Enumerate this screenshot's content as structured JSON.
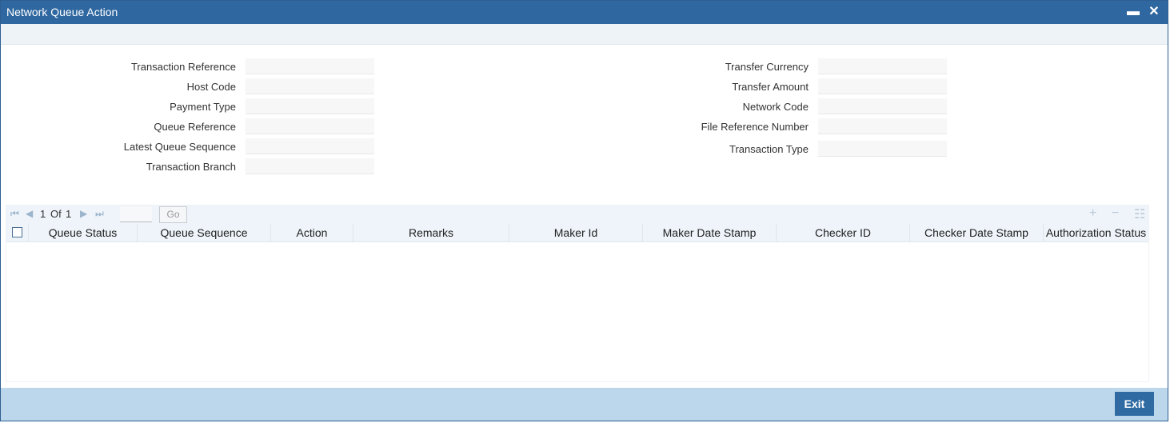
{
  "window": {
    "title": "Network Queue Action",
    "minimize_label": "▬",
    "close_label": "✕"
  },
  "form": {
    "left": [
      {
        "label": "Transaction Reference",
        "value": ""
      },
      {
        "label": "Host Code",
        "value": ""
      },
      {
        "label": "Payment Type",
        "value": ""
      },
      {
        "label": "Queue Reference",
        "value": ""
      },
      {
        "label": "Latest Queue Sequence",
        "value": ""
      },
      {
        "label": "Transaction Branch",
        "value": ""
      }
    ],
    "right": [
      {
        "label": "Transfer Currency",
        "value": ""
      },
      {
        "label": "Transfer Amount",
        "value": ""
      },
      {
        "label": "Network Code",
        "value": ""
      },
      {
        "label": "File Reference Number",
        "value": ""
      },
      {
        "label": "Transaction Type",
        "value": ""
      }
    ]
  },
  "grid": {
    "pager": {
      "current": "1",
      "of_label": "Of",
      "total": "1",
      "go_label": "Go"
    },
    "columns": [
      "Queue Status",
      "Queue Sequence",
      "Action",
      "Remarks",
      "Maker Id",
      "Maker Date Stamp",
      "Checker ID",
      "Checker Date Stamp",
      "Authorization Status"
    ]
  },
  "footer": {
    "exit_label": "Exit"
  }
}
